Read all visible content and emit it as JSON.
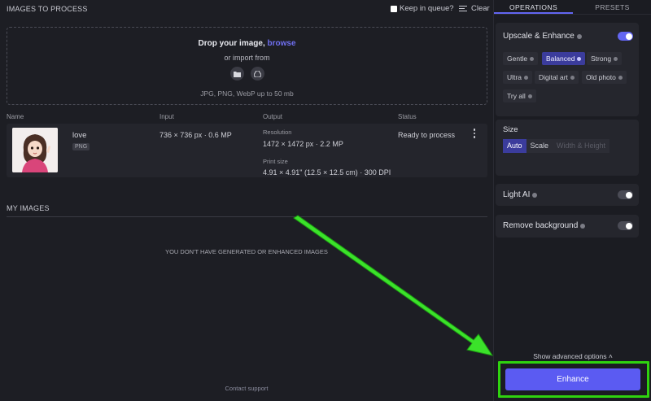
{
  "header": {
    "title": "IMAGES TO PROCESS",
    "keep_label": "Keep in queue?",
    "clear_label": "Clear"
  },
  "dropzone": {
    "title": "Drop your image, ",
    "browse": "browse",
    "sub": "or import from",
    "hint": "JPG, PNG, WebP up to 50 mb",
    "icons": [
      "folder-icon",
      "google-drive-icon"
    ]
  },
  "table": {
    "headers": [
      "Name",
      "Input",
      "Output",
      "Status"
    ],
    "row": {
      "name": "love",
      "type": "PNG",
      "input": "736 × 736 px · 0.6 MP",
      "res_label": "Resolution",
      "res_value": "1472 × 1472 px · 2.2 MP",
      "print_label": "Print size",
      "print_value": "4.91 × 4.91\" (12.5 × 12.5 cm) · 300 DPI",
      "status": "Ready to process"
    }
  },
  "my_images": {
    "title": "MY IMAGES",
    "empty": "YOU DON'T HAVE GENERATED OR ENHANCED IMAGES"
  },
  "footer": {
    "support": "Contact support"
  },
  "panel": {
    "tabs": [
      "OPERATIONS",
      "PRESETS"
    ],
    "upscale": {
      "title": "Upscale & Enhance",
      "enabled": true,
      "chips": [
        "Gentle",
        "Balanced",
        "Strong",
        "Ultra",
        "Digital art",
        "Old photo",
        "Try all"
      ],
      "selected": "Balanced"
    },
    "size": {
      "title": "Size",
      "options": [
        "Auto",
        "Scale",
        "Width & Height"
      ],
      "selected": "Auto"
    },
    "light_ai": {
      "title": "Light AI",
      "enabled": false
    },
    "remove_bg": {
      "title": "Remove background",
      "enabled": false
    },
    "advanced": "Show advanced options",
    "enhance": "Enhance"
  },
  "colors": {
    "accent": "#6366f1",
    "enhance": "#5b5bf2",
    "annotation": "#2fd30f"
  }
}
